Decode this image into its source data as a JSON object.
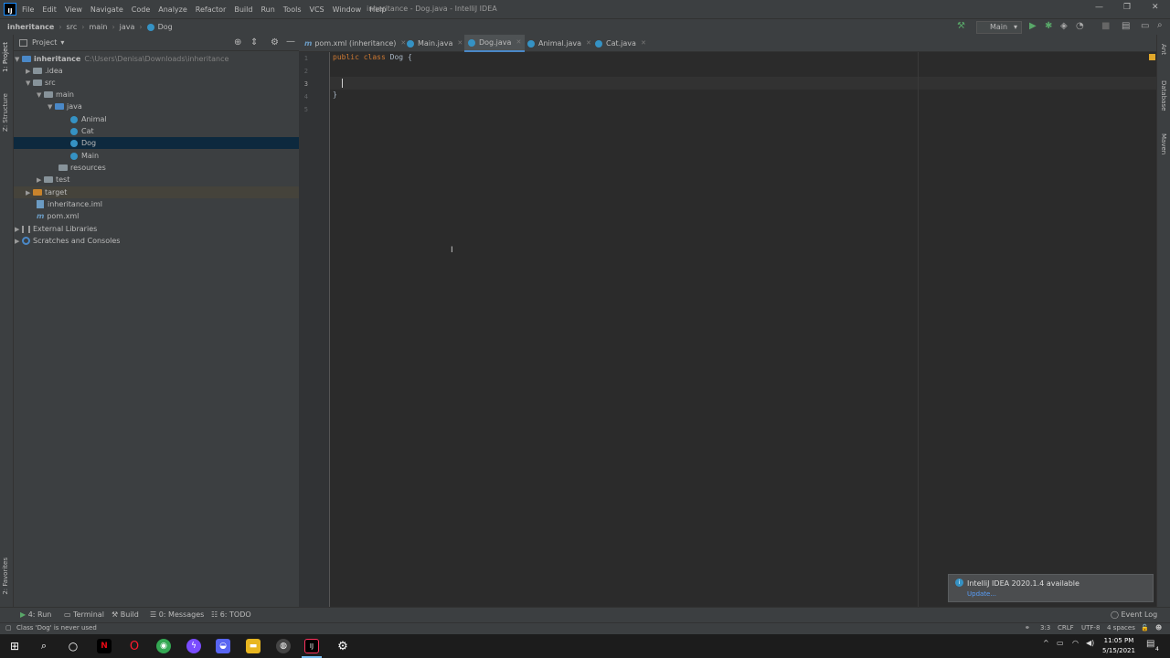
{
  "window": {
    "title": "inheritance - Dog.java - IntelliJ IDEA",
    "menu": [
      "File",
      "Edit",
      "View",
      "Navigate",
      "Code",
      "Analyze",
      "Refactor",
      "Build",
      "Run",
      "Tools",
      "VCS",
      "Window",
      "Help"
    ]
  },
  "navbar": {
    "crumbs": [
      "inheritance",
      "src",
      "main",
      "java",
      "Dog"
    ],
    "run_config": "Main"
  },
  "project_panel": {
    "header": "Project",
    "root": {
      "label": "inheritance",
      "path": "C:\\Users\\Denisa\\Downloads\\inheritance"
    },
    "items": [
      ".idea",
      "src",
      "main",
      "java",
      "Animal",
      "Cat",
      "Dog",
      "Main",
      "resources",
      "test",
      "target",
      "inheritance.iml",
      "pom.xml",
      "External Libraries",
      "Scratches and Consoles"
    ]
  },
  "editor_tabs": [
    "pom.xml (inheritance)",
    "Main.java",
    "Dog.java",
    "Animal.java",
    "Cat.java"
  ],
  "editor": {
    "line_numbers": [
      "1",
      "2",
      "3",
      "4",
      "5"
    ],
    "code": {
      "kw1": "public",
      "kw2": "class",
      "name": "Dog",
      "open": "{",
      "close": "}"
    }
  },
  "left_stripe": {
    "project": "1: Project",
    "structure": "Z: Structure",
    "favorites": "2: Favorites"
  },
  "right_stripe": {
    "ant": "Ant",
    "database": "Database",
    "maven": "Maven"
  },
  "notification": {
    "title": "IntelliJ IDEA 2020.1.4 available",
    "link": "Update..."
  },
  "tool_windows": [
    "4: Run",
    "Terminal",
    "Build",
    "0: Messages",
    "6: TODO"
  ],
  "event_log": "Event Log",
  "status": {
    "message": "Class 'Dog' is never used",
    "position": "3:3",
    "line_sep": "CRLF",
    "encoding": "UTF-8",
    "indent": "4 spaces"
  },
  "taskbar": {
    "time": "11:05 PM",
    "date": "5/15/2021",
    "notif_count": "4"
  },
  "colors": {
    "accent": "#4a88c7",
    "keyword": "#cc7832",
    "selection": "#0d293e"
  }
}
